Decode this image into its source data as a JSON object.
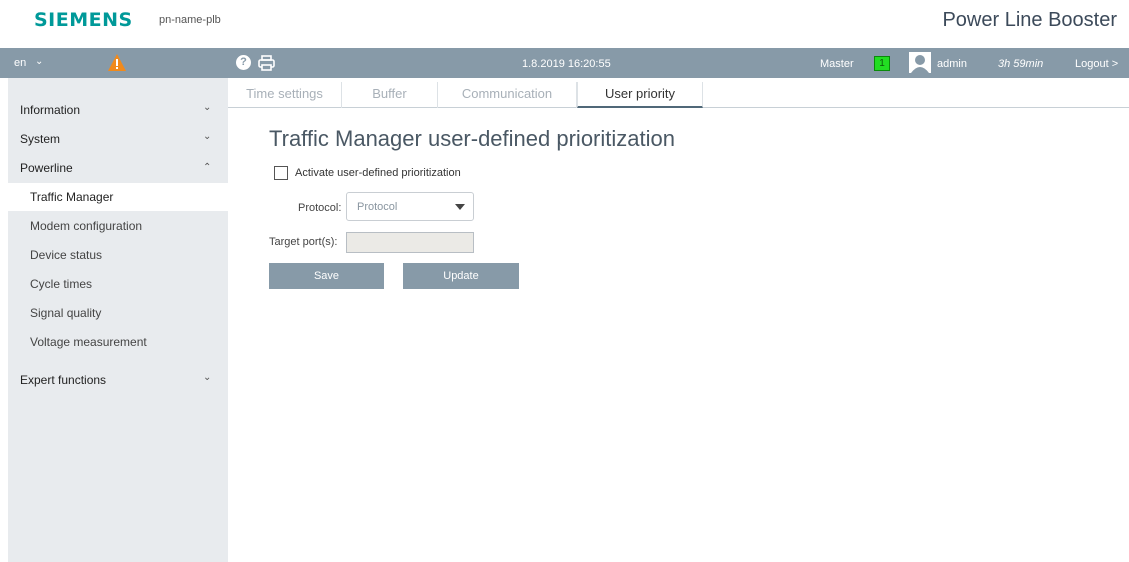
{
  "header": {
    "brand": "SIEMENS",
    "device_name": "pn-name-plb",
    "product_title": "Power Line Booster"
  },
  "toolbar": {
    "language": "en",
    "icons": [
      "chevron-down-icon",
      "warning-icon",
      "help-icon",
      "print-icon",
      "user-icon"
    ],
    "datetime": "1.8.2019 16:20:55",
    "master_label": "Master",
    "master_value": "1",
    "user": "admin",
    "session_time": "3h 59min",
    "logout": "Logout >",
    "colors": {
      "bar": "#879aa8",
      "warning": "#f08a1c",
      "master_indicator": "#22dd22",
      "brand": "#009999"
    }
  },
  "sidebar": {
    "sections": [
      {
        "label": "Information",
        "expanded": false
      },
      {
        "label": "System",
        "expanded": false
      },
      {
        "label": "Powerline",
        "expanded": true
      },
      {
        "label": "Expert functions",
        "expanded": false
      }
    ],
    "powerline_items": [
      "Traffic Manager",
      "Modem configuration",
      "Device status",
      "Cycle times",
      "Signal quality",
      "Voltage measurement"
    ],
    "active_item": "Traffic Manager"
  },
  "tabs": [
    "Time settings",
    "Buffer",
    "Communication",
    "User priority"
  ],
  "active_tab": "User priority",
  "content": {
    "title": "Traffic Manager user-defined prioritization",
    "activate_label": "Activate user-defined prioritization",
    "activate_checked": false,
    "protocol_label": "Protocol:",
    "protocol_value": "Protocol",
    "target_label": "Target port(s):",
    "target_value": "",
    "save_label": "Save",
    "update_label": "Update"
  }
}
